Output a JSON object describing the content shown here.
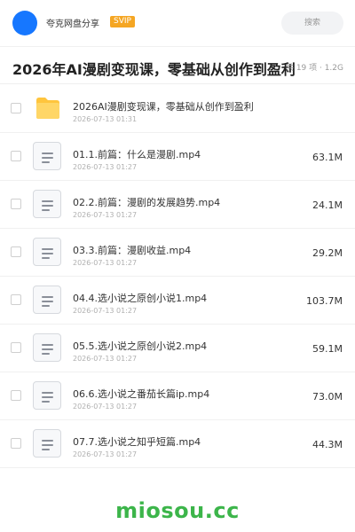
{
  "header": {
    "share_name": "夸克网盘分享",
    "badge": "SVIP",
    "search_placeholder": "搜索"
  },
  "title": "2026年AI漫剧变现课，零基础从创作到盈利",
  "summary": "共 19 项 · 1.2G",
  "files": [
    {
      "type": "folder",
      "name": "2026AI漫剧变现课，零基础从创作到盈利",
      "date": "2026-07-13 01:31",
      "size": ""
    },
    {
      "type": "video",
      "name": "01.1.前篇：什么是漫剧.mp4",
      "date": "2026-07-13 01:27",
      "size": "63.1M"
    },
    {
      "type": "video",
      "name": "02.2.前篇：漫剧的发展趋势.mp4",
      "date": "2026-07-13 01:27",
      "size": "24.1M"
    },
    {
      "type": "video",
      "name": "03.3.前篇：漫剧收益.mp4",
      "date": "2026-07-13 01:27",
      "size": "29.2M"
    },
    {
      "type": "video",
      "name": "04.4.选小说之原创小说1.mp4",
      "date": "2026-07-13 01:27",
      "size": "103.7M"
    },
    {
      "type": "video",
      "name": "05.5.选小说之原创小说2.mp4",
      "date": "2026-07-13 01:27",
      "size": "59.1M"
    },
    {
      "type": "video",
      "name": "06.6.选小说之番茄长篇ip.mp4",
      "date": "2026-07-13 01:27",
      "size": "73.0M"
    },
    {
      "type": "video",
      "name": "07.7.选小说之知乎短篇.mp4",
      "date": "2026-07-13 01:27",
      "size": "44.3M"
    }
  ],
  "watermark": "miosou.cc",
  "colors": {
    "accent": "#1677ff",
    "svip": "#f5a623",
    "folder": "#ffc53d",
    "watermark": "#3cb54a"
  }
}
